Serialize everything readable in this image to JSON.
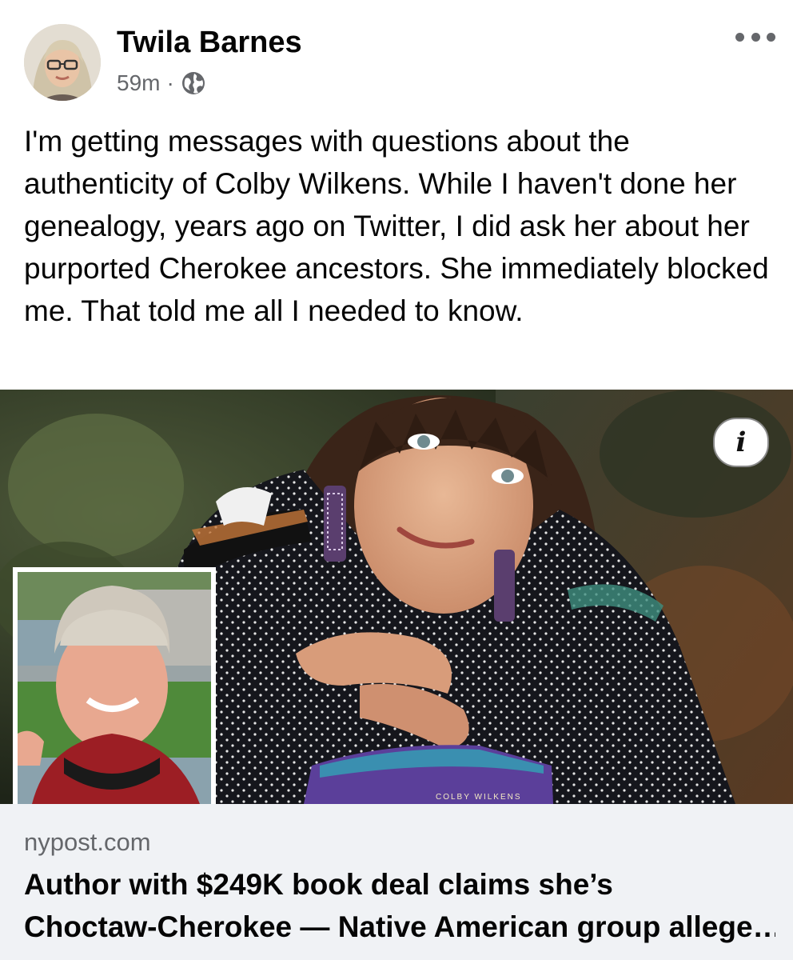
{
  "post": {
    "author_name": "Twila Barnes",
    "timestamp": "59m",
    "separator": "·",
    "audience_icon": "globe-icon",
    "menu_icon": "more-options-icon",
    "text": "I'm getting messages with questions about the authenticity of Colby Wilkens. While I haven't done her genealogy, years ago on Twitter, I did ask her about her purported Cherokee ancestors. She immediately blocked me. That told me all I needed to know."
  },
  "media": {
    "info_label": "i",
    "book_spine_text": "COLBY WILKENS"
  },
  "link_preview": {
    "domain": "nypost.com",
    "headline_line1": "Author with $249K book deal claims she’s",
    "headline_line2": "Choctaw-Cherokee — Native American group allege…"
  },
  "colors": {
    "text_primary": "#050505",
    "text_secondary": "#65676b",
    "card_background": "#f0f2f5"
  }
}
